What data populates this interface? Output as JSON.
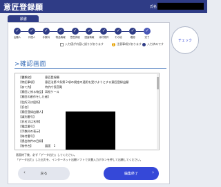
{
  "header": {
    "title": "意匠登録願",
    "name_label": "氏名"
  },
  "tab": {
    "label": "願書"
  },
  "steps": [
    {
      "label": "出願人",
      "state": "done"
    },
    {
      "label": "代理人",
      "state": "done"
    },
    {
      "label": "手数料",
      "state": "done"
    },
    {
      "label": "物品情報",
      "state": "done"
    },
    {
      "label": "意匠詳細",
      "state": "done"
    },
    {
      "label": "図面情報",
      "state": "done"
    },
    {
      "label": "添付物件",
      "state": "done"
    },
    {
      "label": "その他",
      "state": "done"
    },
    {
      "label": "確認",
      "state": "done"
    },
    {
      "label": "完了",
      "state": "active"
    }
  ],
  "legend": {
    "required": "入力値が内容に誤りがあります",
    "warning": "注意事項があります",
    "done": "入力済みです"
  },
  "section": {
    "title": "確認画面"
  },
  "rows": [
    {
      "key": "【書類名】",
      "value": "意匠登録願"
    },
    {
      "key": "【特記事項】",
      "value": "意匠法第４条第２項の規定の適用を受けようとする意匠登録出願"
    },
    {
      "key": "【あて先】",
      "value": "特許庁長官殿"
    },
    {
      "key": "【意匠に係る物品】",
      "value": "耳栓ケース"
    },
    {
      "key": "【意匠の創作をした者】",
      "value": ""
    },
    {
      "key": "【住所又は居所】",
      "value": ""
    },
    {
      "key": "【氏名】",
      "value": ""
    },
    {
      "key": "【意匠登録出願人】",
      "value": ""
    },
    {
      "key": "【識別番号】",
      "value": ""
    },
    {
      "key": "【氏名又は名称】",
      "value": ""
    },
    {
      "key": "【電話番号】",
      "value": ""
    },
    {
      "key": "【手数料の表示】",
      "value": ""
    },
    {
      "key": "【納付番号】",
      "value": ""
    },
    {
      "key": "【提出物件の目録】",
      "value": ""
    },
    {
      "key": "【物件名】",
      "value": "図面　1"
    }
  ],
  "notes": [
    "画面終了後、必ず「データ出力」してください。",
    "「データ出力」した出力を、インターネット出願ソフトで文書入力ボタンを押して出願してください。"
  ],
  "buttons": {
    "back": "戻る",
    "finish": "編集終了",
    "check": "チェック"
  }
}
